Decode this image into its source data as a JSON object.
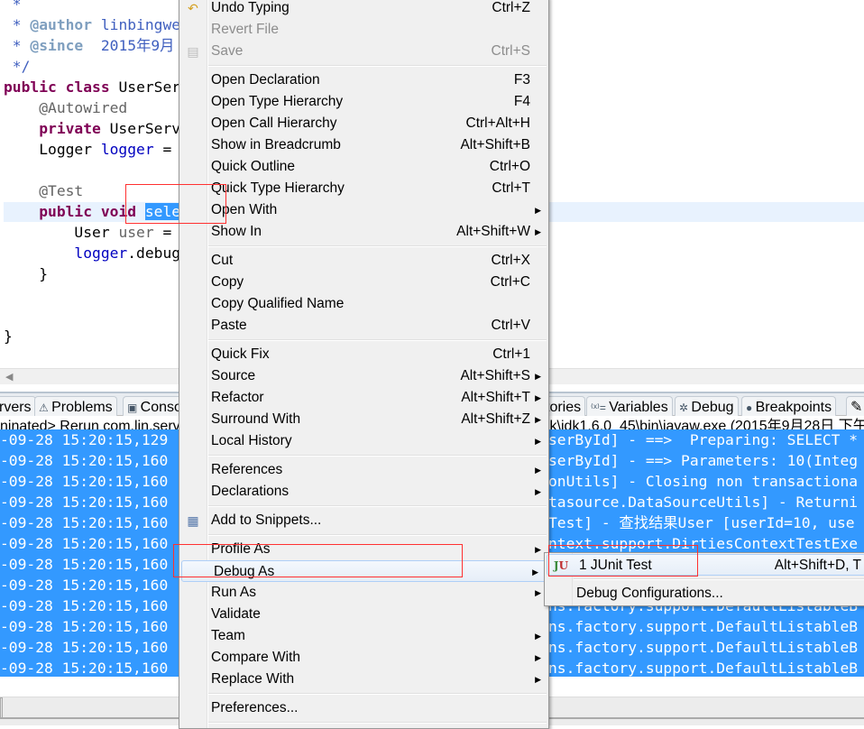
{
  "editor": {
    "lines": [
      {
        "parts": [
          {
            "c": "cm",
            "t": " *"
          }
        ]
      },
      {
        "parts": [
          {
            "c": "cm",
            "t": " * "
          },
          {
            "c": "tag",
            "t": "@author"
          },
          {
            "c": "cm",
            "t": " linbingwe"
          }
        ]
      },
      {
        "parts": [
          {
            "c": "cm",
            "t": " * "
          },
          {
            "c": "tag",
            "t": "@since"
          },
          {
            "c": "cm",
            "t": "  2015年9月"
          }
        ]
      },
      {
        "parts": [
          {
            "c": "cm",
            "t": " */"
          }
        ]
      },
      {
        "parts": [
          {
            "c": "kw",
            "t": "public"
          },
          {
            "c": "",
            "t": " "
          },
          {
            "c": "kw",
            "t": "class"
          },
          {
            "c": "",
            "t": " UserSer"
          }
        ]
      },
      {
        "parts": [
          {
            "c": "an",
            "t": "    @Autowired"
          }
        ]
      },
      {
        "parts": [
          {
            "c": "kw",
            "t": "    private"
          },
          {
            "c": "",
            "t": " UserServ"
          }
        ]
      },
      {
        "parts": [
          {
            "c": "",
            "t": "    Logger "
          },
          {
            "c": "fd",
            "t": "logger"
          },
          {
            "c": "",
            "t": " ="
          }
        ]
      },
      {
        "parts": []
      },
      {
        "parts": [
          {
            "c": "an",
            "t": "    @Test"
          }
        ]
      },
      {
        "parts": [
          {
            "c": "kw",
            "t": "    public"
          },
          {
            "c": "",
            "t": " "
          },
          {
            "c": "kw",
            "t": "void"
          },
          {
            "c": "",
            "t": " "
          },
          {
            "c": "sel",
            "t": "sele"
          }
        ]
      },
      {
        "parts": [
          {
            "c": "",
            "t": "        User "
          },
          {
            "c": "an",
            "t": "user"
          },
          {
            "c": "",
            "t": " ="
          }
        ]
      },
      {
        "parts": [
          {
            "c": "fd",
            "t": "        logger"
          },
          {
            "c": "",
            "t": ".debug"
          }
        ]
      },
      {
        "parts": [
          {
            "c": "",
            "t": "    }"
          }
        ]
      },
      {
        "parts": []
      },
      {
        "parts": []
      },
      {
        "parts": [
          {
            "c": "",
            "t": "}"
          }
        ]
      }
    ]
  },
  "tabs": [
    {
      "label": "rvers",
      "icon": "servers-icon"
    },
    {
      "label": "Problems",
      "icon": "problems-icon"
    },
    {
      "label": "Conso",
      "icon": "console-icon"
    },
    {
      "label": "tories",
      "icon": "history-icon"
    },
    {
      "label": "Variables",
      "icon": "variables-icon"
    },
    {
      "label": "Debug",
      "icon": "debug-bug-icon"
    },
    {
      "label": "Breakpoints",
      "icon": "breakpoints-icon"
    }
  ],
  "console": {
    "header_left": "ninated> Rerun com.lin.serv",
    "header_right": "lk\\jdk1.6.0_45\\bin\\javaw.exe (2015年9月28日 下午",
    "log_left": [
      "-09-28 15:20:15,129",
      "-09-28 15:20:15,160",
      "-09-28 15:20:15,160",
      "-09-28 15:20:15,160",
      "-09-28 15:20:15,160",
      "-09-28 15:20:15,160",
      "-09-28 15:20:15,160",
      "-09-28 15:20:15,160",
      "-09-28 15:20:15,160",
      "-09-28 15:20:15,160",
      "-09-28 15:20:15,160",
      "-09-28 15:20:15,160"
    ],
    "log_right": [
      "serById] - ==>  Preparing: SELECT *",
      "serById] - ==> Parameters: 10(Integ",
      "onUtils] - Closing non transactiona",
      "tasource.DataSourceUtils] - Returni",
      "Test] - 查找结果User [userId=10, use",
      "ntext.support.DirtiesContextTestExe",
      "",
      "",
      "ns.factory.support.DefaultListableB",
      "ns.factory.support.DefaultListableB",
      "ns.factory.support.DefaultListableB",
      "ns.factory.support.DefaultListableB"
    ]
  },
  "context_menu": [
    {
      "label": "Undo Typing",
      "shortcut": "Ctrl+Z",
      "icon": "undo-icon"
    },
    {
      "label": "Revert File",
      "disabled": true
    },
    {
      "label": "Save",
      "shortcut": "Ctrl+S",
      "disabled": true,
      "icon": "save-icon",
      "sep": true
    },
    {
      "label": "Open Declaration",
      "shortcut": "F3"
    },
    {
      "label": "Open Type Hierarchy",
      "shortcut": "F4"
    },
    {
      "label": "Open Call Hierarchy",
      "shortcut": "Ctrl+Alt+H"
    },
    {
      "label": "Show in Breadcrumb",
      "shortcut": "Alt+Shift+B"
    },
    {
      "label": "Quick Outline",
      "shortcut": "Ctrl+O"
    },
    {
      "label": "Quick Type Hierarchy",
      "shortcut": "Ctrl+T"
    },
    {
      "label": "Open With",
      "submenu": true
    },
    {
      "label": "Show In",
      "shortcut": "Alt+Shift+W",
      "submenu": true,
      "sep": true
    },
    {
      "label": "Cut",
      "shortcut": "Ctrl+X"
    },
    {
      "label": "Copy",
      "shortcut": "Ctrl+C"
    },
    {
      "label": "Copy Qualified Name"
    },
    {
      "label": "Paste",
      "shortcut": "Ctrl+V",
      "sep": true
    },
    {
      "label": "Quick Fix",
      "shortcut": "Ctrl+1"
    },
    {
      "label": "Source",
      "shortcut": "Alt+Shift+S",
      "submenu": true
    },
    {
      "label": "Refactor",
      "shortcut": "Alt+Shift+T",
      "submenu": true
    },
    {
      "label": "Surround With",
      "shortcut": "Alt+Shift+Z",
      "submenu": true
    },
    {
      "label": "Local History",
      "submenu": true,
      "sep": true
    },
    {
      "label": "References",
      "submenu": true
    },
    {
      "label": "Declarations",
      "submenu": true,
      "sep": true
    },
    {
      "label": "Add to Snippets...",
      "icon": "snippets-icon",
      "sep": true
    },
    {
      "label": "Profile As",
      "submenu": true
    },
    {
      "label": "Debug As",
      "submenu": true,
      "hover": true
    },
    {
      "label": "Run As",
      "submenu": true
    },
    {
      "label": "Validate"
    },
    {
      "label": "Team",
      "submenu": true
    },
    {
      "label": "Compare With",
      "submenu": true
    },
    {
      "label": "Replace With",
      "submenu": true,
      "sep": true
    },
    {
      "label": "Preferences...",
      "sep": true
    }
  ],
  "debug_submenu": {
    "junit_label": "1 JUnit Test",
    "junit_shortcut": "Alt+Shift+D, T",
    "junit_icon_text": "JU",
    "configs_label": "Debug Configurations..."
  },
  "colors": {
    "selection": "#3399ff",
    "annotation_box": "#ff3030",
    "keyword": "#7f0055"
  }
}
